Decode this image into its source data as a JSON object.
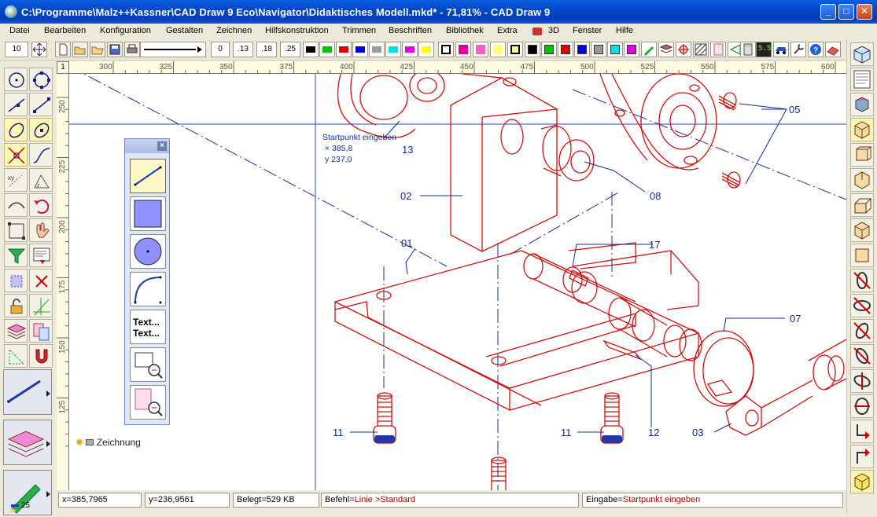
{
  "window": {
    "title": "C:\\Programme\\Malz++Kassner\\CAD Draw 9 Eco\\Navigator\\Didaktisches Modell.mkd* - 71,81% - CAD Draw 9",
    "min_label": "_",
    "max_label": "□",
    "close_label": "✕"
  },
  "menu": [
    "Datei",
    "Bearbeiten",
    "Konfiguration",
    "Gestalten",
    "Zeichnen",
    "Hilfskonstruktion",
    "Trimmen",
    "Beschriften",
    "Bibliothek",
    "Extra",
    "3D",
    "Fenster",
    "Hilfe"
  ],
  "toolbar": {
    "size_value": "10",
    "line_widths": [
      "0",
      ".13",
      ".18",
      ".25"
    ],
    "line_colors": [
      "#000000",
      "#00c000",
      "#e00000",
      "#0000e0",
      "#9a9a9a",
      "#00e0e0",
      "#e000e0",
      "#ffff00"
    ],
    "fill_colors": [
      "#000000",
      "#00c000",
      "#e00000",
      "#0000e0",
      "#9a9a9a",
      "#00e0e0",
      "#e000e0"
    ],
    "scale_label": "5.5"
  },
  "ruler": {
    "top_ticks": [
      "300",
      "325",
      "350",
      "375",
      "400",
      "425",
      "450",
      "475",
      "500",
      "525",
      "550",
      "575",
      "600"
    ],
    "left_ticks": [
      "250",
      "225",
      "200",
      "175",
      "150",
      "125"
    ],
    "corner": "1"
  },
  "floating_palette": {
    "tools": [
      "line-tool",
      "rectangle-tool",
      "circle-tool",
      "arc-tool",
      "text-tool",
      "zoom-window-tool",
      "zoom-page-tool"
    ],
    "text_tool_label_1": "Text...",
    "text_tool_label_2": "Text..."
  },
  "canvas": {
    "prompt_text": "Startpunkt eingeben",
    "prompt_x": "×  385,8",
    "prompt_y": "y  237,0",
    "layer_label": "Zeichnung",
    "part_labels": [
      "13",
      "02",
      "01",
      "05",
      "08",
      "17",
      "07",
      "11",
      "11",
      "12",
      "03"
    ]
  },
  "leftpal": {
    "bottom_value": "25"
  },
  "status": {
    "x": "x=385,7965",
    "y": "y=236,9561",
    "belegt": "Belegt=529 KB",
    "befehl_prefix": "Befehl=",
    "befehl_value": "Linie >Standard",
    "eingabe_prefix": "Eingabe=",
    "eingabe_value": "Startpunkt eingeben"
  },
  "colors": {
    "title_blue": "#0047c8",
    "drawing_red": "#d01010",
    "annotation_blue": "#102a9a"
  }
}
